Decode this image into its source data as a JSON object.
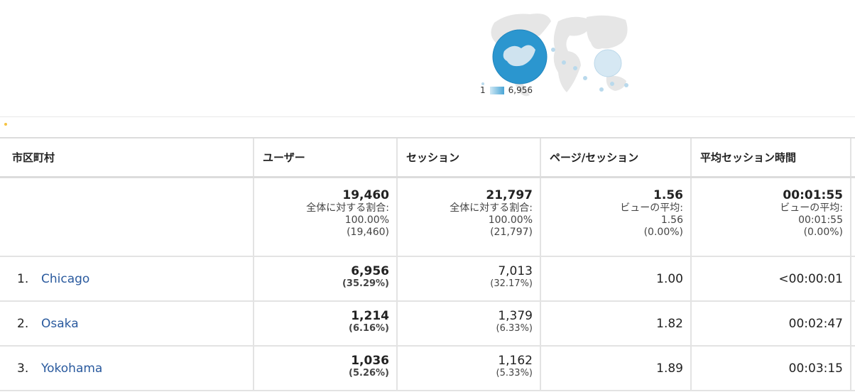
{
  "map": {
    "legend_min": "1",
    "legend_max": "6,956",
    "bubble_color": "#2b96cf",
    "legend_start_color": "#cfe8f4",
    "legend_end_color": "#4aa5d6"
  },
  "table": {
    "headers": [
      "市区町村",
      "ユーザー",
      "セッション",
      "ページ/セッション",
      "平均セッション時間"
    ],
    "summary": {
      "users": {
        "total": "19,460",
        "label": "全体に対する割合:",
        "pct": "100.00%",
        "abs": "(19,460)"
      },
      "sessions": {
        "total": "21,797",
        "label": "全体に対する割合:",
        "pct": "100.00%",
        "abs": "(21,797)"
      },
      "pages": {
        "total": "1.56",
        "label": "ビューの平均:",
        "avg": "1.56",
        "diff": "(0.00%)"
      },
      "duration": {
        "total": "00:01:55",
        "label": "ビューの平均:",
        "avg": "00:01:55",
        "diff": "(0.00%)"
      }
    },
    "rows": [
      {
        "rank": "1.",
        "city": "Chicago",
        "users": "6,956",
        "users_pct": "(35.29%)",
        "sessions": "7,013",
        "sessions_pct": "(32.17%)",
        "pages": "1.00",
        "duration": "<00:00:01"
      },
      {
        "rank": "2.",
        "city": "Osaka",
        "users": "1,214",
        "users_pct": "(6.16%)",
        "sessions": "1,379",
        "sessions_pct": "(6.33%)",
        "pages": "1.82",
        "duration": "00:02:47"
      },
      {
        "rank": "3.",
        "city": "Yokohama",
        "users": "1,036",
        "users_pct": "(5.26%)",
        "sessions": "1,162",
        "sessions_pct": "(5.33%)",
        "pages": "1.89",
        "duration": "00:03:15"
      }
    ]
  }
}
